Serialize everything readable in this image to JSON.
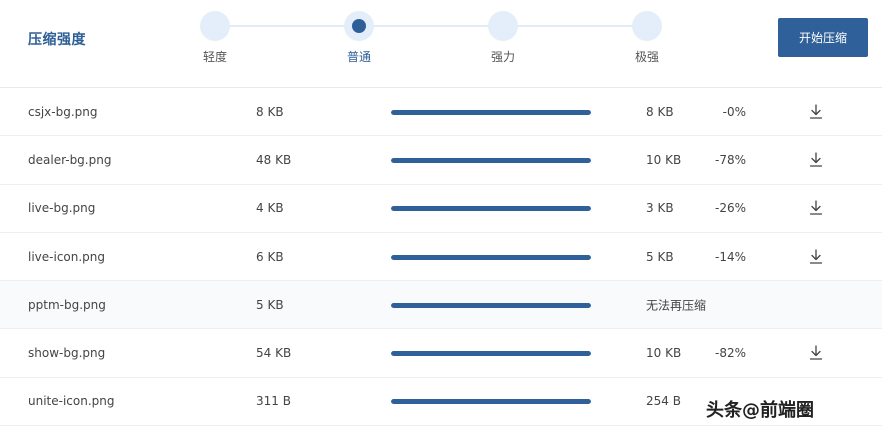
{
  "header": {
    "title": "压缩强度",
    "start_label": "开始压缩"
  },
  "levels": [
    {
      "label": "轻度",
      "active": false
    },
    {
      "label": "普通",
      "active": true
    },
    {
      "label": "强力",
      "active": false
    },
    {
      "label": "极强",
      "active": false
    }
  ],
  "files": [
    {
      "name": "csjx-bg.png",
      "size": "8 KB",
      "progress": 1.0,
      "new_size": "8 KB",
      "ratio": "-0%",
      "download_icon": "download-icon"
    },
    {
      "name": "dealer-bg.png",
      "size": "48 KB",
      "progress": 1.0,
      "new_size": "10 KB",
      "ratio": "-78%",
      "download_icon": "download-icon"
    },
    {
      "name": "live-bg.png",
      "size": "4 KB",
      "progress": 1.0,
      "new_size": "3 KB",
      "ratio": "-26%",
      "download_icon": "download-icon"
    },
    {
      "name": "live-icon.png",
      "size": "6 KB",
      "progress": 1.0,
      "new_size": "5 KB",
      "ratio": "-14%",
      "download_icon": "download-icon"
    },
    {
      "name": "pptm-bg.png",
      "size": "5 KB",
      "progress": 1.0,
      "new_size": "无法再压缩",
      "ratio": "",
      "download_icon": ""
    },
    {
      "name": "show-bg.png",
      "size": "54 KB",
      "progress": 1.0,
      "new_size": "10 KB",
      "ratio": "-82%",
      "download_icon": "download-icon"
    },
    {
      "name": "unite-icon.png",
      "size": "311 B",
      "progress": 1.0,
      "new_size": "254 B",
      "ratio": "",
      "download_icon": ""
    }
  ],
  "watermark": "头条@前端圈",
  "colors": {
    "accent": "#2f6099",
    "step_bg": "#e4eefa",
    "bar_track": "#dfe7f2"
  }
}
